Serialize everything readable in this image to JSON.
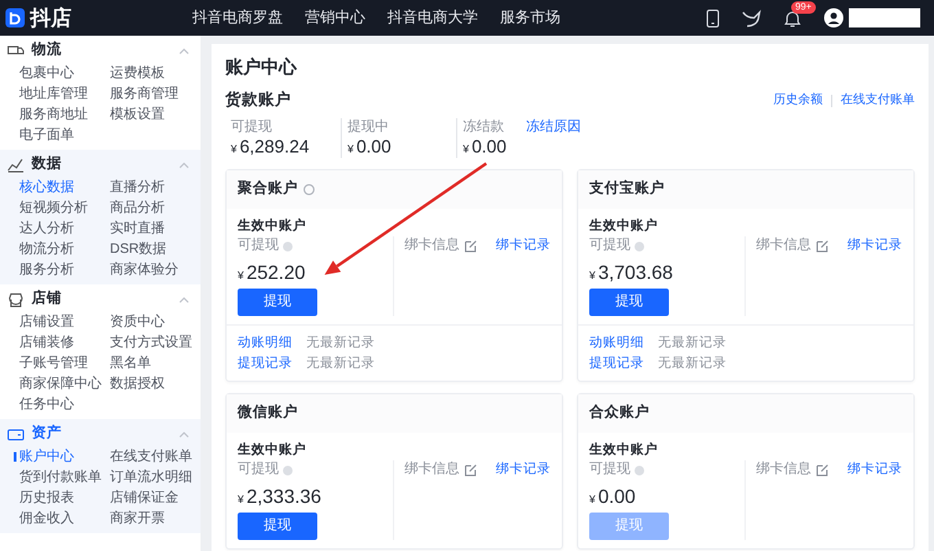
{
  "topbar": {
    "logo_text": "抖店",
    "nav": [
      "抖音电商罗盘",
      "营销中心",
      "抖音电商大学",
      "服务市场"
    ],
    "notification_badge": "99+"
  },
  "sidebar": {
    "sections": [
      {
        "title": "物流",
        "expanded": true,
        "highlighted": false,
        "selected": false,
        "items": [
          {
            "label": "包裹中心",
            "selected": false
          },
          {
            "label": "运费模板",
            "selected": false
          },
          {
            "label": "地址库管理",
            "selected": false
          },
          {
            "label": "服务商管理",
            "selected": false
          },
          {
            "label": "服务商地址",
            "selected": false
          },
          {
            "label": "模板设置",
            "selected": false
          },
          {
            "label": "电子面单",
            "selected": false
          }
        ]
      },
      {
        "title": "数据",
        "expanded": true,
        "highlighted": true,
        "selected": false,
        "items": [
          {
            "label": "核心数据",
            "selected": true
          },
          {
            "label": "直播分析",
            "selected": false
          },
          {
            "label": "短视频分析",
            "selected": false
          },
          {
            "label": "商品分析",
            "selected": false
          },
          {
            "label": "达人分析",
            "selected": false
          },
          {
            "label": "实时直播",
            "selected": false
          },
          {
            "label": "物流分析",
            "selected": false
          },
          {
            "label": "DSR数据",
            "selected": false
          },
          {
            "label": "服务分析",
            "selected": false
          },
          {
            "label": "商家体验分",
            "selected": false
          }
        ]
      },
      {
        "title": "店铺",
        "expanded": true,
        "highlighted": false,
        "selected": false,
        "items": [
          {
            "label": "店铺设置",
            "selected": false
          },
          {
            "label": "资质中心",
            "selected": false
          },
          {
            "label": "店铺装修",
            "selected": false
          },
          {
            "label": "支付方式设置",
            "selected": false
          },
          {
            "label": "子账号管理",
            "selected": false
          },
          {
            "label": "黑名单",
            "selected": false
          },
          {
            "label": "商家保障中心",
            "selected": false
          },
          {
            "label": "数据授权",
            "selected": false
          },
          {
            "label": "任务中心",
            "selected": false
          }
        ]
      },
      {
        "title": "资产",
        "expanded": true,
        "highlighted": true,
        "selected": true,
        "items": [
          {
            "label": "账户中心",
            "selected": true
          },
          {
            "label": "在线支付账单",
            "selected": false
          },
          {
            "label": "货到付款账单",
            "selected": false
          },
          {
            "label": "订单流水明细",
            "selected": false
          },
          {
            "label": "历史报表",
            "selected": false
          },
          {
            "label": "店铺保证金",
            "selected": false
          },
          {
            "label": "佣金收入",
            "selected": false
          },
          {
            "label": "商家开票",
            "selected": false
          }
        ]
      }
    ]
  },
  "page_title": "账户中心",
  "goods_account": {
    "title": "货款账户",
    "links": [
      "历史余额",
      "在线支付账单"
    ],
    "balances": [
      {
        "label": "可提现",
        "currency": "¥",
        "amount": "6,289.24"
      },
      {
        "label": "提现中",
        "currency": "¥",
        "amount": "0.00"
      },
      {
        "label": "冻结款",
        "link": "冻结原因",
        "currency": "¥",
        "amount": "0.00"
      }
    ]
  },
  "accounts": [
    {
      "title": "聚合账户",
      "help": true,
      "status_title": "生效中账户",
      "available_label": "可提现",
      "currency": "¥",
      "amount": "252.20",
      "button": {
        "label": "提现",
        "disabled": false
      },
      "card_info_label": "绑卡信息",
      "card_record_link": "绑卡记录",
      "records": [
        {
          "link": "动账明细",
          "text": "无最新记录"
        },
        {
          "link": "提现记录",
          "text": "无最新记录"
        }
      ]
    },
    {
      "title": "支付宝账户",
      "help": false,
      "status_title": "生效中账户",
      "available_label": "可提现",
      "currency": "¥",
      "amount": "3,703.68",
      "button": {
        "label": "提现",
        "disabled": false
      },
      "card_info_label": "绑卡信息",
      "card_record_link": "绑卡记录",
      "records": [
        {
          "link": "动账明细",
          "text": "无最新记录"
        },
        {
          "link": "提现记录",
          "text": "无最新记录"
        }
      ]
    },
    {
      "title": "微信账户",
      "help": false,
      "status_title": "生效中账户",
      "available_label": "可提现",
      "currency": "¥",
      "amount": "2,333.36",
      "button": {
        "label": "提现",
        "disabled": false
      },
      "card_info_label": "绑卡信息",
      "card_record_link": "绑卡记录"
    },
    {
      "title": "合众账户",
      "help": false,
      "status_title": "生效中账户",
      "available_label": "可提现",
      "currency": "¥",
      "amount": "0.00",
      "button": {
        "label": "提现",
        "disabled": true
      },
      "card_info_label": "绑卡信息",
      "card_record_link": "绑卡记录"
    }
  ]
}
